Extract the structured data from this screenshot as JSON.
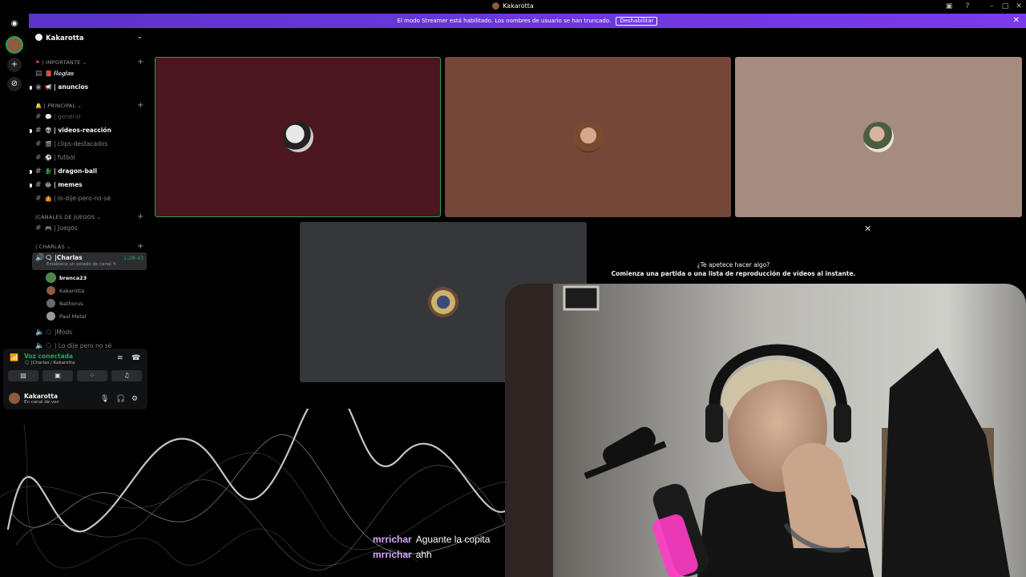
{
  "window": {
    "title": "Kakarotta"
  },
  "banner": {
    "text": "El modo Streamer está habilitado. Los nombres de usuario se han truncado.",
    "button_label": "Deshabilitar"
  },
  "sidebar": {
    "server_name": "Kakarotta",
    "categories": [
      {
        "label": "| IMPORTANTE ⌄"
      },
      {
        "label": "| PRINCIPAL ⌄"
      },
      {
        "label": "|CANALES DE JUEGOS ⌄"
      },
      {
        "label": "| CHARLAS ⌄"
      }
    ],
    "channels": [
      {
        "emoji": "📕",
        "label": "𝑹𝒆𝒈𝒍𝒂𝒔"
      },
      {
        "emoji": "📢",
        "label": "| anuncios"
      },
      {
        "emoji": "💬",
        "label": "| general"
      },
      {
        "emoji": "👽",
        "label": "| videos-reacción"
      },
      {
        "emoji": "🎬",
        "label": "| clips-destacados"
      },
      {
        "emoji": "⚽",
        "label": "| futbol"
      },
      {
        "emoji": "🐉",
        "label": "| dragon-ball"
      },
      {
        "emoji": "😂",
        "label": "| memes"
      },
      {
        "emoji": "🤷",
        "label": "| lo-dije-pero-no-sé"
      },
      {
        "emoji": "🎮",
        "label": "| Juegos"
      }
    ],
    "voice_channel": {
      "label": "🗨 |Charlas",
      "timer": "1:28:43",
      "status": "Establece un estado de canal ✎"
    },
    "voice_users": [
      {
        "name": "brenca23",
        "color": "#5a7d4e"
      },
      {
        "name": "Kakarotta",
        "color": "#8d5b40"
      },
      {
        "name": "Nathorus",
        "color": "#6b6b6b"
      },
      {
        "name": "Paul Metal",
        "color": "#9a9a9a"
      }
    ],
    "more_channels": [
      {
        "label": "🗨 |Mods"
      },
      {
        "label": "🗨 | Lo dije pero no sé"
      }
    ]
  },
  "voice_panel": {
    "status": "Voz conectada",
    "channel": "🗨 |Charlas / Kakarotta",
    "username": "Kakarotta",
    "user_status": "En canal de voz"
  },
  "activity": {
    "title": "¿Te apetece hacer algo?",
    "subtitle": "Comienza una partida o una lista de reproducción de vídeos al instante."
  },
  "chat": [
    {
      "user": "mrrichar",
      "message": "Aguante la copita"
    },
    {
      "user": "mrrichar",
      "message": "ahh"
    }
  ],
  "colors": {
    "accent": "#23a55a",
    "banner": "#7c3aed",
    "chat_name": "#d8a7f7"
  }
}
